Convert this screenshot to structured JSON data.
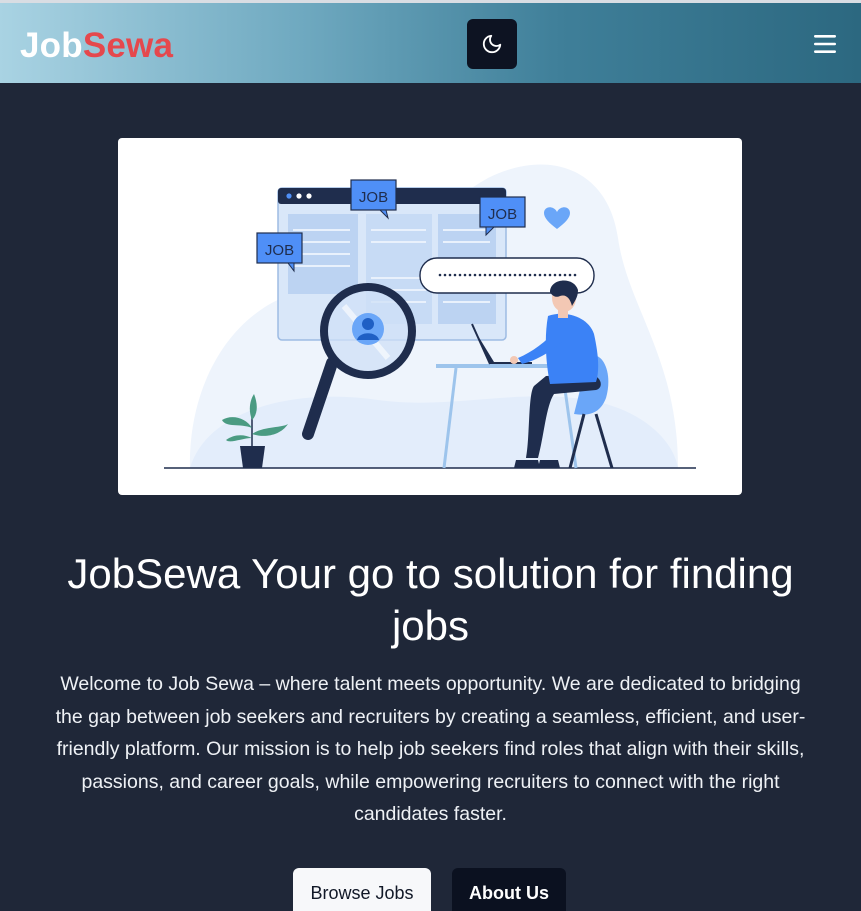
{
  "navbar": {
    "brand_part1": "Job",
    "brand_part2": "Sewa",
    "brand_colors": {
      "job": "#ffffff",
      "sewa": "#e5484d"
    },
    "theme_toggle_icon": "moon-icon",
    "menu_icon": "hamburger-menu-icon"
  },
  "hero": {
    "illustration": {
      "icon": "job-search-illustration",
      "tags": [
        "JOB",
        "JOB",
        "JOB"
      ]
    },
    "headline": "JobSewa Your go to solution for finding jobs",
    "description": "Welcome to Job Sewa – where talent meets opportunity. We are dedicated to bridging the gap between job seekers and recruiters by creating a seamless, efficient, and user-friendly platform. Our mission is to help job seekers find roles that align with their skills, passions, and career goals, while empowering recruiters to connect with the right candidates faster.",
    "buttons": {
      "browse": "Browse Jobs",
      "about": "About Us"
    }
  },
  "colors": {
    "background": "#1f2738",
    "accent_blue": "#3b82f6",
    "dark_button": "#0b1120"
  }
}
